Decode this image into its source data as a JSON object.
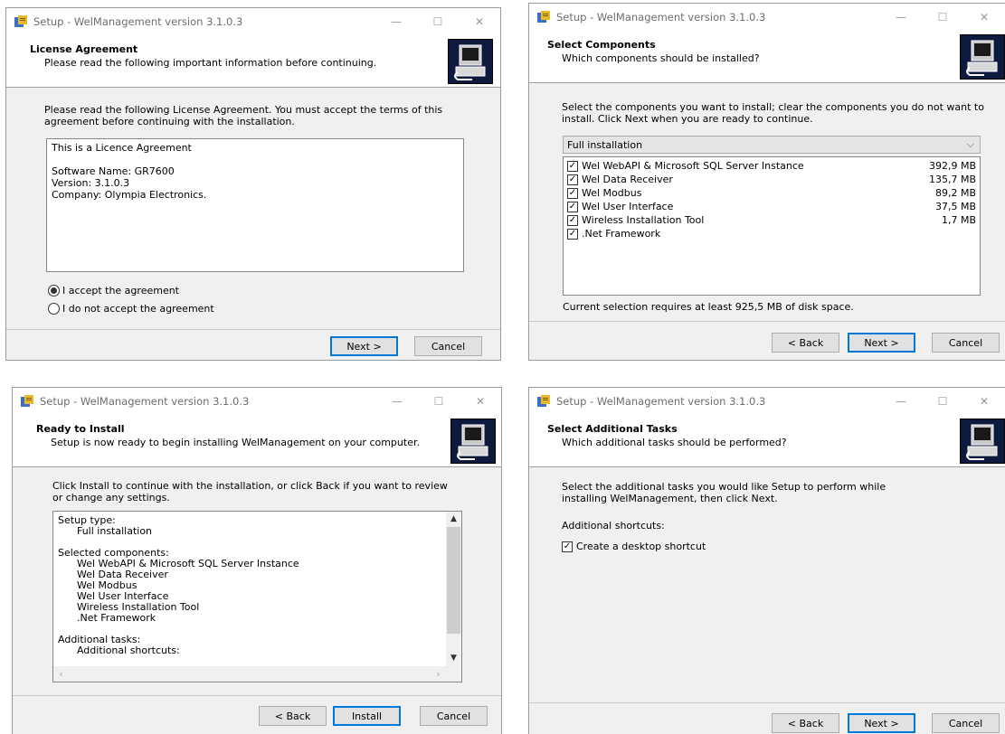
{
  "windows": {
    "license": {
      "title": "Setup - WelManagement version 3.1.0.3",
      "header_title": "License Agreement",
      "header_sub": "Please read the following important information before continuing.",
      "instructions": "Please read the following License Agreement. You must accept the terms of this agreement before continuing with the installation.",
      "license_text": "This is a Licence Agreement\n\nSoftware Name: GR7600\nVersion: 3.1.0.3\nCompany: Olympia Electronics.",
      "accept_label": "I accept the agreement",
      "decline_label": "I do not accept the agreement",
      "accept_selected": true,
      "next_label": "Next >",
      "cancel_label": "Cancel"
    },
    "components": {
      "title": "Setup - WelManagement version 3.1.0.3",
      "header_title": "Select Components",
      "header_sub": "Which components should be installed?",
      "instructions": "Select the components you want to install; clear the components you do not want to install. Click Next when you are ready to continue.",
      "install_type": "Full installation",
      "items": [
        {
          "label": "Wel WebAPI & Microsoft SQL Server Instance",
          "size": "392,9 MB",
          "checked": true
        },
        {
          "label": "Wel Data Receiver",
          "size": "135,7 MB",
          "checked": true
        },
        {
          "label": "Wel Modbus",
          "size": "89,2 MB",
          "checked": true
        },
        {
          "label": "Wel User Interface",
          "size": "37,5 MB",
          "checked": true
        },
        {
          "label": "Wireless Installation Tool",
          "size": "1,7 MB",
          "checked": true
        },
        {
          "label": ".Net Framework",
          "size": "",
          "checked": true
        }
      ],
      "disk_space": "Current selection requires at least 925,5 MB of disk space.",
      "back_label": "< Back",
      "next_label": "Next >",
      "cancel_label": "Cancel"
    },
    "ready": {
      "title": "Setup - WelManagement version 3.1.0.3",
      "header_title": "Ready to Install",
      "header_sub": "Setup is now ready to begin installing WelManagement on your computer.",
      "instructions": "Click Install to continue with the installation, or click Back if you want to review or change any settings.",
      "memo": "Setup type:\n      Full installation\n\nSelected components:\n      Wel WebAPI & Microsoft SQL Server Instance\n      Wel Data Receiver\n      Wel Modbus\n      Wel User Interface\n      Wireless Installation Tool\n      .Net Framework\n\nAdditional tasks:\n      Additional shortcuts:",
      "back_label": "< Back",
      "install_label": "Install",
      "cancel_label": "Cancel"
    },
    "tasks": {
      "title": "Setup - WelManagement version 3.1.0.3",
      "header_title": "Select Additional Tasks",
      "header_sub": "Which additional tasks should be performed?",
      "instructions": "Select the additional tasks you would like Setup to perform while installing WelManagement, then click Next.",
      "group_label": "Additional shortcuts:",
      "desktop_shortcut_label": "Create a desktop shortcut",
      "desktop_shortcut_checked": true,
      "back_label": "< Back",
      "next_label": "Next >",
      "cancel_label": "Cancel"
    }
  },
  "colors": {
    "accent": "#0078d7",
    "window_bg": "#f0f0f0",
    "header_bg": "#ffffff",
    "wizard_image_bg": "#0d1a3e"
  }
}
